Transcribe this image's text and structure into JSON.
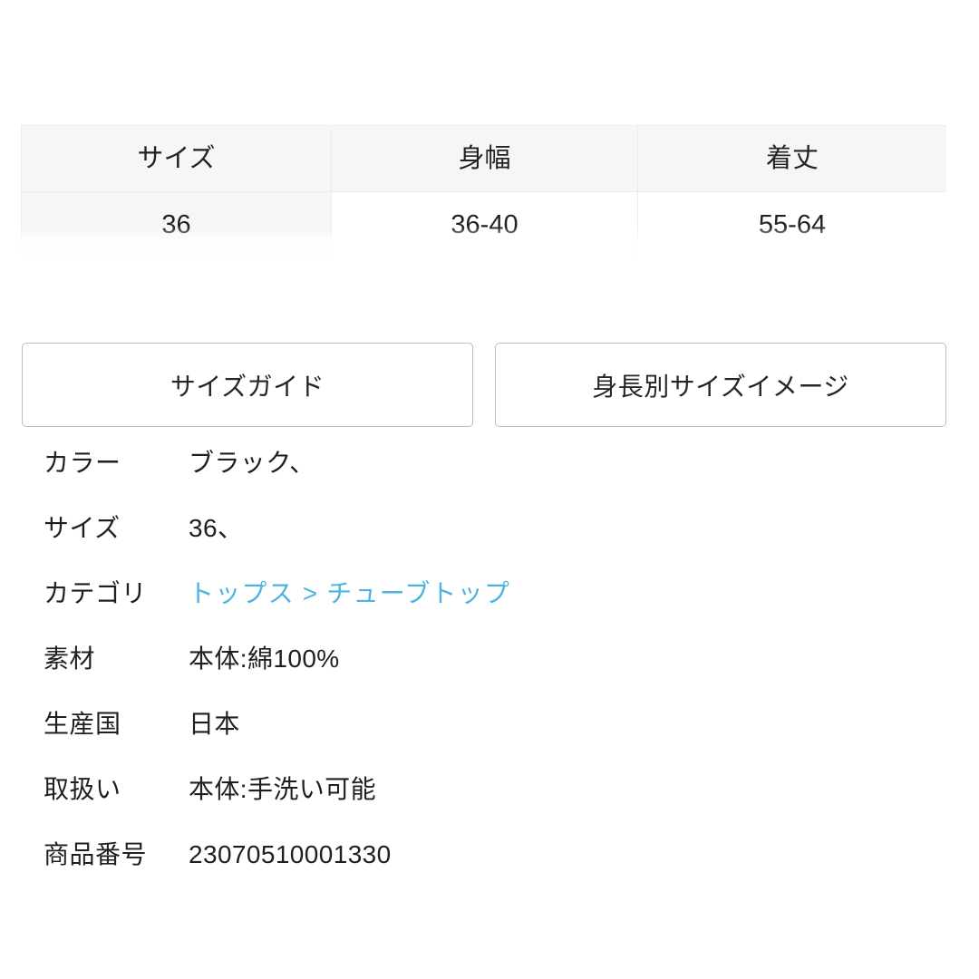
{
  "size_table": {
    "headers": [
      "サイズ",
      "身幅",
      "着丈"
    ],
    "rows": [
      [
        "36",
        "36-40",
        "55-64"
      ]
    ],
    "header_bg": "#f6f6f6",
    "border_color": "#ececec"
  },
  "guide_buttons": [
    {
      "label": "サイズガイド",
      "name": "size-guide-button"
    },
    {
      "label": "身長別サイズイメージ",
      "name": "height-size-image-button"
    }
  ],
  "specs": [
    {
      "label": "カラー",
      "value": "ブラック、",
      "is_link": false
    },
    {
      "label": "サイズ",
      "value": "36、",
      "is_link": false
    },
    {
      "label": "カテゴリ",
      "value": "トップス > チューブトップ",
      "is_link": true
    },
    {
      "label": "素材",
      "value": "本体:綿100%",
      "is_link": false
    },
    {
      "label": "生産国",
      "value": "日本",
      "is_link": false
    },
    {
      "label": "取扱い",
      "value": "本体:手洗い可能",
      "is_link": false
    },
    {
      "label": "商品番号",
      "value": "23070510001330",
      "is_link": false
    }
  ],
  "colors": {
    "link": "#4db4e0",
    "text": "#1f1f1f",
    "button_border": "#bdbdbd",
    "page_bg": "#ffffff"
  }
}
